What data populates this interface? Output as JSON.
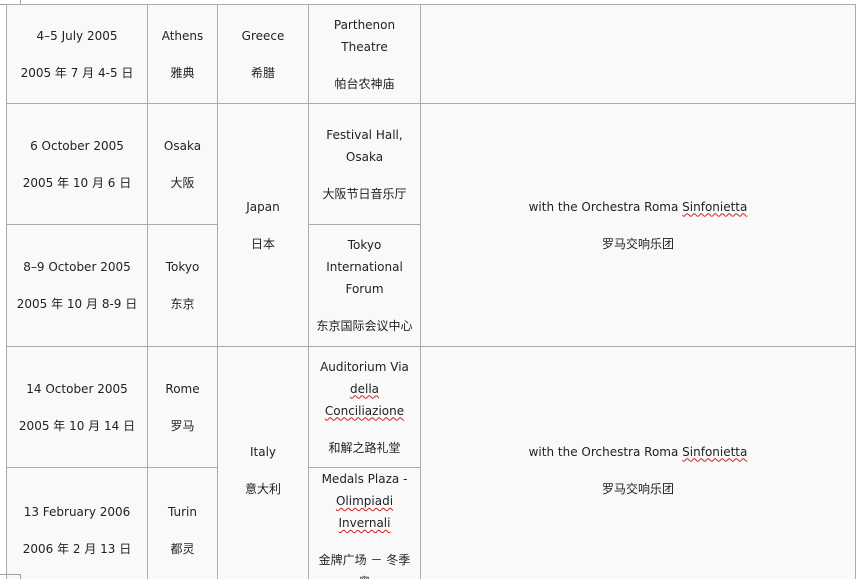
{
  "rows": [
    {
      "date_en": "4–5 July 2005",
      "date_cn": "2005 年 7 月 4-5 日",
      "city_en": "Athens",
      "city_cn": "雅典",
      "country_en": "Greece",
      "country_cn": "希腊",
      "venue_en_1": "Parthenon Theatre",
      "venue_cn": "帕台农神庙"
    },
    {
      "date_en": "6 October 2005",
      "date_cn": "2005 年 10 月 6 日",
      "city_en": "Osaka",
      "city_cn": "大阪",
      "venue_en_1": "Festival Hall,",
      "venue_en_2": "Osaka",
      "venue_cn": "大阪节日音乐厅"
    },
    {
      "date_en": "8–9 October 2005",
      "date_cn": "2005 年 10 月 8-9 日",
      "city_en": "Tokyo",
      "city_cn": "东京",
      "venue_en_1": "Tokyo International",
      "venue_en_2": "Forum",
      "venue_cn": "东京国际会议中心"
    },
    {
      "date_en": "14 October 2005",
      "date_cn": "2005 年 10 月 14 日",
      "city_en": "Rome",
      "city_cn": "罗马",
      "venue_en_1": "Auditorium Via",
      "venue_en_2": "della Conciliazione",
      "venue_cn": "和解之路礼堂"
    },
    {
      "date_en": "13 February 2006",
      "date_cn": "2006 年 2 月 13 日",
      "city_en": "Turin",
      "city_cn": "都灵",
      "venue_en_1": "Medals Plaza -",
      "venue_en_2": "Olimpiadi Invernali",
      "venue_cn": "金牌广场 － 冬季奥"
    }
  ],
  "groups": {
    "japan": {
      "country_en": "Japan",
      "country_cn": "日本",
      "notes_en_prefix": "with the Orchestra Roma ",
      "notes_en_marked": "Sinfonietta",
      "notes_cn": "罗马交响乐团"
    },
    "italy": {
      "country_en": "Italy",
      "country_cn": "意大利",
      "notes_en_prefix": "with the Orchestra Roma ",
      "notes_en_marked": "Sinfonietta",
      "notes_cn": "罗马交响乐团"
    }
  }
}
